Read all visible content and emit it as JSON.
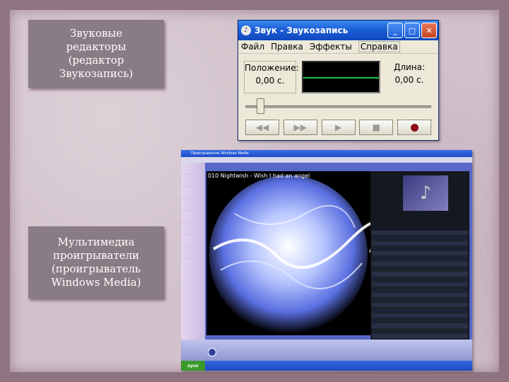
{
  "slide": {
    "box1_lines": [
      "Звуковые",
      "редакторы",
      "(редактор",
      "Звукозапись)"
    ],
    "box2_lines": [
      "Мультимедиа",
      "проигрыватели",
      "(проигрыватель",
      "Windows Media)"
    ]
  },
  "recorder": {
    "title": "Звук - Звукозапись",
    "menu": [
      "Файл",
      "Правка",
      "Эффекты",
      "Справка"
    ],
    "position_label": "Положение:",
    "position_value": "0,00 с.",
    "length_label": "Длина:",
    "length_value": "0,00 с.",
    "icons": [
      "rewind-icon",
      "fast-forward-icon",
      "play-icon",
      "stop-icon",
      "record-icon"
    ]
  },
  "media_player": {
    "title": "Проигрыватель Windows Media",
    "song_title": "010 Nightwish - Wish I had an angel",
    "taskbar_start": "пуск"
  }
}
